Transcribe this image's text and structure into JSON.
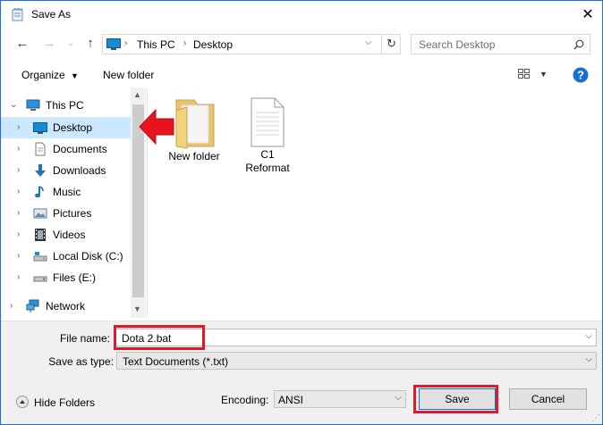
{
  "window": {
    "title": "Save As"
  },
  "nav": {
    "breadcrumb": [
      "This PC",
      "Desktop"
    ],
    "search_placeholder": "Search Desktop"
  },
  "toolbar": {
    "organize_label": "Organize",
    "new_folder_label": "New folder"
  },
  "sidebar": {
    "items": [
      {
        "label": "This PC",
        "icon": "pc-icon"
      },
      {
        "label": "Desktop",
        "icon": "desktop-icon",
        "selected": true
      },
      {
        "label": "Documents",
        "icon": "documents-icon"
      },
      {
        "label": "Downloads",
        "icon": "downloads-icon"
      },
      {
        "label": "Music",
        "icon": "music-icon"
      },
      {
        "label": "Pictures",
        "icon": "pictures-icon"
      },
      {
        "label": "Videos",
        "icon": "videos-icon"
      },
      {
        "label": "Local Disk (C:)",
        "icon": "local-disk-icon"
      },
      {
        "label": "Files (E:)",
        "icon": "drive-icon"
      },
      {
        "label": "Network",
        "icon": "network-icon"
      }
    ]
  },
  "files": [
    {
      "name": "New folder",
      "type": "folder"
    },
    {
      "name": "C1 Reformat",
      "type": "document"
    }
  ],
  "form": {
    "file_name_label": "File name:",
    "file_name_value": "Dota 2.bat",
    "save_as_type_label": "Save as type:",
    "save_as_type_value": "Text Documents (*.txt)",
    "encoding_label": "Encoding:",
    "encoding_value": "ANSI"
  },
  "footer": {
    "hide_folders_label": "Hide Folders",
    "save_label": "Save",
    "cancel_label": "Cancel"
  },
  "colors": {
    "accent": "#0078d7",
    "highlight": "#e0192a",
    "selection": "#cce8ff"
  }
}
